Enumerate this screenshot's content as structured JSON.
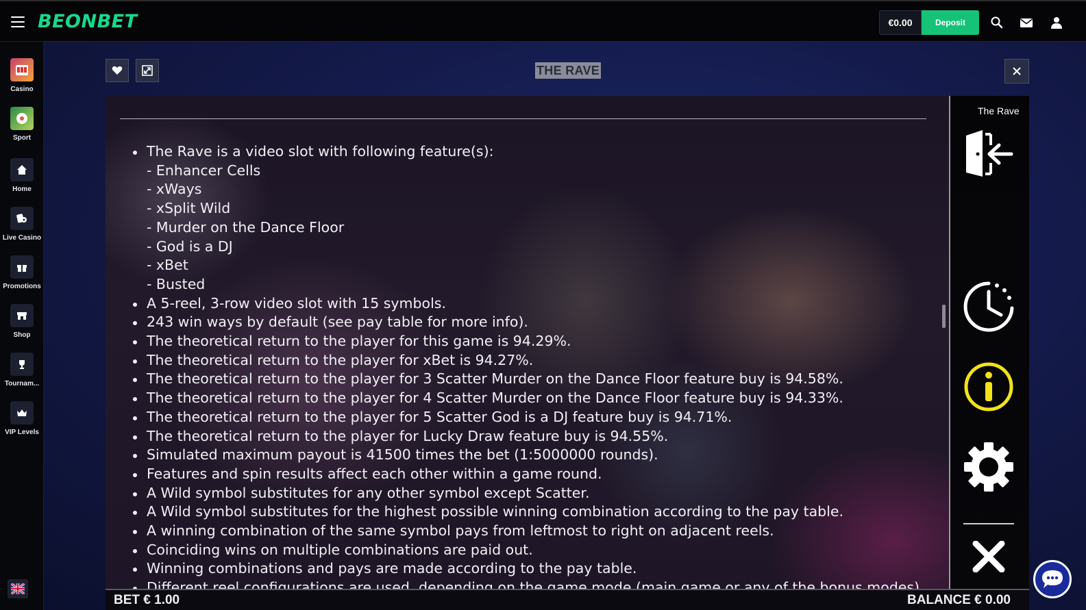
{
  "header": {
    "logo_text": "BEONBET",
    "balance": "€0.00",
    "deposit_label": "Deposit"
  },
  "rail": {
    "items": [
      {
        "label": "Casino",
        "icon": "casino-icon"
      },
      {
        "label": "Sport",
        "icon": "sport-icon"
      },
      {
        "label": "Home",
        "icon": "home-icon"
      },
      {
        "label": "Live Casino",
        "icon": "live-casino-icon"
      },
      {
        "label": "Promotions",
        "icon": "gift-icon"
      },
      {
        "label": "Shop",
        "icon": "shop-icon"
      },
      {
        "label": "Tournam...",
        "icon": "trophy-icon"
      },
      {
        "label": "VIP Levels",
        "icon": "crown-icon"
      }
    ],
    "language_icon": "uk-flag-icon"
  },
  "frame": {
    "title": "THE RAVE"
  },
  "game": {
    "name_tag": "The Rave",
    "rules": [
      {
        "text": "The Rave is a video slot with following feature(s):",
        "sub": false
      },
      {
        "text": "- Enhancer Cells",
        "sub": true
      },
      {
        "text": "- xWays",
        "sub": true
      },
      {
        "text": "- xSplit Wild",
        "sub": true
      },
      {
        "text": "- Murder on the Dance Floor",
        "sub": true
      },
      {
        "text": "- God is a DJ",
        "sub": true
      },
      {
        "text": "- xBet",
        "sub": true
      },
      {
        "text": "- Busted",
        "sub": true
      },
      {
        "text": "A 5-reel, 3-row video slot with 15 symbols.",
        "sub": false
      },
      {
        "text": "243 win ways by default (see pay table for more info).",
        "sub": false
      },
      {
        "text": "The theoretical return to the player for this game is 94.29%.",
        "sub": false
      },
      {
        "text": "The theoretical return to the player for xBet is 94.27%.",
        "sub": false
      },
      {
        "text": "The theoretical return to the player for 3 Scatter Murder on the Dance Floor feature buy is 94.58%.",
        "sub": false
      },
      {
        "text": "The theoretical return to the player for 4 Scatter Murder on the Dance Floor feature buy is 94.33%.",
        "sub": false
      },
      {
        "text": "The theoretical return to the player for 5 Scatter God is a DJ feature buy is 94.71%.",
        "sub": false
      },
      {
        "text": "The theoretical return to the player for Lucky Draw feature buy is 94.55%.",
        "sub": false
      },
      {
        "text": "Simulated maximum payout is 41500 times the bet (1:5000000 rounds).",
        "sub": false
      },
      {
        "text": "Features and spin results affect each other within a game round.",
        "sub": false
      },
      {
        "text": "A Wild symbol substitutes for any other symbol except Scatter.",
        "sub": false
      },
      {
        "text": "A Wild symbol substitutes for the highest possible winning combination according to the pay table.",
        "sub": false
      },
      {
        "text": "A winning combination of the same symbol pays from leftmost to right on adjacent reels.",
        "sub": false
      },
      {
        "text": "Coinciding wins on multiple combinations are paid out.",
        "sub": false
      },
      {
        "text": "Winning combinations and pays are made according to the pay table.",
        "sub": false
      },
      {
        "text": "Different reel configurations are used, depending on the game mode (main game or any of the bonus modes).",
        "sub": false
      }
    ],
    "bet_text": "BET € 1.00",
    "balance_text": "BALANCE € 0.00"
  },
  "colors": {
    "brand": "#16d98a",
    "deposit": "#15c277",
    "info_icon": "#f2e21a",
    "chat": "#1b2a9a"
  }
}
